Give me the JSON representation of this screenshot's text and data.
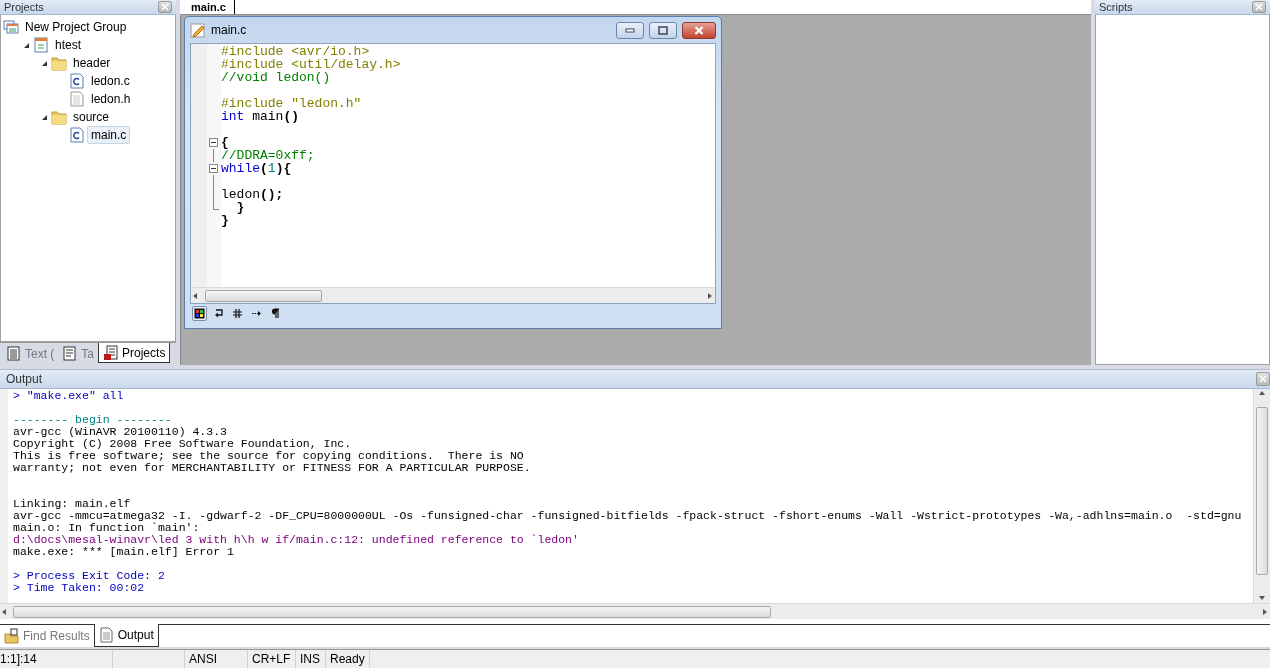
{
  "projects_panel": {
    "title": "Projects",
    "tree": [
      {
        "label": "New Project Group",
        "kind": "group",
        "selected": false,
        "children": [
          {
            "label": "htest",
            "kind": "project",
            "expanded": true,
            "selected": false,
            "children": [
              {
                "label": "header",
                "kind": "folder",
                "expanded": true,
                "selected": false,
                "children": [
                  {
                    "label": "ledon.c",
                    "kind": "c-file",
                    "selected": false
                  },
                  {
                    "label": "ledon.h",
                    "kind": "h-file",
                    "selected": false
                  }
                ]
              },
              {
                "label": "source",
                "kind": "folder",
                "expanded": true,
                "selected": false,
                "children": [
                  {
                    "label": "main.c",
                    "kind": "c-file",
                    "selected": true
                  }
                ]
              }
            ]
          }
        ]
      }
    ],
    "tabs": [
      {
        "label": "Text (",
        "kind": "text",
        "selected": false
      },
      {
        "label": "Ta",
        "kind": "doc",
        "selected": false
      },
      {
        "label": "Projects",
        "kind": "projects",
        "selected": true
      }
    ]
  },
  "editor_tabs": [
    {
      "label": "main.c",
      "selected": true
    }
  ],
  "editor_window": {
    "title": "main.c",
    "lines": [
      {
        "kind": "code",
        "segments": [
          {
            "kind": "preproc",
            "text": "#include <avr/io.h>"
          }
        ]
      },
      {
        "kind": "code",
        "segments": [
          {
            "kind": "preproc",
            "text": "#include <util/delay.h>"
          }
        ]
      },
      {
        "kind": "code",
        "segments": [
          {
            "kind": "comment",
            "text": "//void ledon()"
          }
        ]
      },
      {
        "kind": "blank"
      },
      {
        "kind": "code",
        "segments": [
          {
            "kind": "preproc",
            "text": "#include \"ledon.h\""
          }
        ]
      },
      {
        "kind": "code",
        "segments": [
          {
            "kind": "keyword",
            "text": "int"
          },
          {
            "kind": "plain",
            "text": " main"
          },
          {
            "kind": "bold",
            "text": "()"
          }
        ]
      },
      {
        "kind": "blank"
      },
      {
        "kind": "code",
        "fold_toggle": true,
        "segments": [
          {
            "kind": "bold",
            "text": "{"
          }
        ]
      },
      {
        "kind": "code",
        "fold_body": true,
        "segments": [
          {
            "kind": "comment",
            "text": "//DDRA=0xff;"
          }
        ]
      },
      {
        "kind": "code",
        "fold_toggle": true,
        "segments": [
          {
            "kind": "keyword",
            "text": "while"
          },
          {
            "kind": "bold",
            "text": "("
          },
          {
            "kind": "number",
            "text": "1"
          },
          {
            "kind": "bold",
            "text": "){"
          }
        ]
      },
      {
        "kind": "blank",
        "fold_body": true
      },
      {
        "kind": "code",
        "fold_body": true,
        "segments": [
          {
            "kind": "plain",
            "text": "ledon"
          },
          {
            "kind": "bold",
            "text": "();"
          }
        ]
      },
      {
        "kind": "code",
        "fold_end": true,
        "segments": [
          {
            "kind": "bold",
            "text": "  }"
          }
        ]
      },
      {
        "kind": "code",
        "segments": [
          {
            "kind": "bold",
            "text": "}"
          }
        ]
      }
    ]
  },
  "scripts_panel": {
    "title": "Scripts"
  },
  "output_panel": {
    "title": "Output",
    "lines": [
      {
        "kind": "command",
        "text": "> \"make.exe\" all"
      },
      {
        "kind": "blank"
      },
      {
        "kind": "separator",
        "text": "-------- begin --------"
      },
      {
        "kind": "plain",
        "text": "avr-gcc (WinAVR 20100110) 4.3.3"
      },
      {
        "kind": "plain",
        "text": "Copyright (C) 2008 Free Software Foundation, Inc."
      },
      {
        "kind": "plain",
        "text": "This is free software; see the source for copying conditions.  There is NO"
      },
      {
        "kind": "plain",
        "text": "warranty; not even for MERCHANTABILITY or FITNESS FOR A PARTICULAR PURPOSE."
      },
      {
        "kind": "blank"
      },
      {
        "kind": "blank"
      },
      {
        "kind": "plain",
        "text": "Linking: main.elf"
      },
      {
        "kind": "plain",
        "text": "avr-gcc -mmcu=atmega32 -I. -gdwarf-2 -DF_CPU=8000000UL -Os -funsigned-char -funsigned-bitfields -fpack-struct -fshort-enums -Wall -Wstrict-prototypes -Wa,-adhlns=main.o  -std=gnu"
      },
      {
        "kind": "plain",
        "text": "main.o: In function `main':"
      },
      {
        "kind": "error",
        "text": "d:\\docs\\mesal-winavr\\led 3 with h\\h w if/main.c:12: undefined reference to `ledon'"
      },
      {
        "kind": "plain",
        "text": "make.exe: *** [main.elf] Error 1"
      },
      {
        "kind": "blank"
      },
      {
        "kind": "info",
        "text": "> Process Exit Code: 2"
      },
      {
        "kind": "info",
        "text": "> Time Taken: 00:02"
      }
    ],
    "tabs": [
      {
        "label": "Find Results",
        "kind": "find",
        "selected": false
      },
      {
        "label": "Output",
        "kind": "output",
        "selected": true
      }
    ]
  },
  "status_bar": [
    "1:1]:14",
    "ANSI",
    "CR+LF",
    "INS",
    "Ready"
  ]
}
